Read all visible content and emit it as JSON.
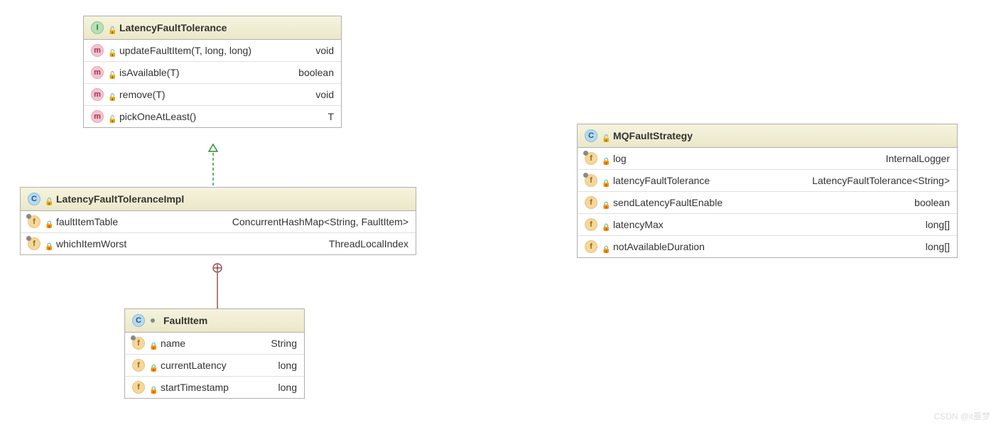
{
  "classes": {
    "latencyFaultTolerance": {
      "name": "LatencyFaultTolerance",
      "rows": [
        {
          "name": "updateFaultItem(T, long, long)",
          "type": "void"
        },
        {
          "name": "isAvailable(T)",
          "type": "boolean"
        },
        {
          "name": "remove(T)",
          "type": "void"
        },
        {
          "name": "pickOneAtLeast()",
          "type": "T"
        }
      ]
    },
    "latencyFaultToleranceImpl": {
      "name": "LatencyFaultToleranceImpl",
      "rows": [
        {
          "name": "faultItemTable",
          "type": "ConcurrentHashMap<String, FaultItem>"
        },
        {
          "name": "whichItemWorst",
          "type": "ThreadLocalIndex"
        }
      ]
    },
    "faultItem": {
      "name": "FaultItem",
      "rows": [
        {
          "name": "name",
          "type": "String"
        },
        {
          "name": "currentLatency",
          "type": "long"
        },
        {
          "name": "startTimestamp",
          "type": "long"
        }
      ]
    },
    "mqFaultStrategy": {
      "name": "MQFaultStrategy",
      "rows": [
        {
          "name": "log",
          "type": "InternalLogger"
        },
        {
          "name": "latencyFaultTolerance",
          "type": "LatencyFaultTolerance<String>"
        },
        {
          "name": "sendLatencyFaultEnable",
          "type": "boolean"
        },
        {
          "name": "latencyMax",
          "type": "long[]"
        },
        {
          "name": "notAvailableDuration",
          "type": "long[]"
        }
      ]
    }
  },
  "relations": [
    {
      "from": "LatencyFaultToleranceImpl",
      "to": "LatencyFaultTolerance",
      "kind": "realization"
    },
    {
      "from": "FaultItem",
      "to": "LatencyFaultToleranceImpl",
      "kind": "nested"
    }
  ],
  "watermark": "CSDN @it噩梦"
}
